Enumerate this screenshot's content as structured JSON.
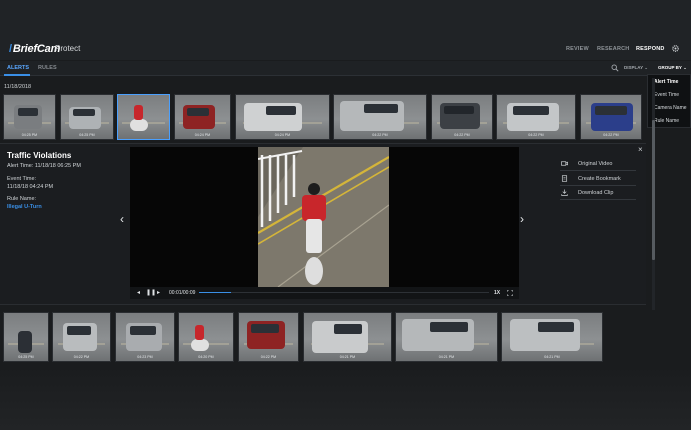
{
  "header": {
    "logo_brand": "BriefCam",
    "logo_product": "Protect",
    "nav": [
      {
        "label": "REVIEW",
        "active": false
      },
      {
        "label": "RESEARCH",
        "active": false
      },
      {
        "label": "RESPOND",
        "active": true
      }
    ],
    "settings_icon": "gear-icon"
  },
  "tabs": [
    {
      "label": "ALERTS",
      "active": true
    },
    {
      "label": "RULES",
      "active": false
    }
  ],
  "toolbar": {
    "search_icon": "search-icon",
    "display_label": "DISPLAY",
    "group_by_label": "GROUP BY",
    "group_by_menu": [
      "Alert Time",
      "Event Time",
      "Camera Name",
      "Rule Name"
    ]
  },
  "date_group": "11/18/2018",
  "top_thumbnails": [
    {
      "time": "04:25 PM",
      "subject": "gray car"
    },
    {
      "time": "04:25 PM",
      "subject": "silver car"
    },
    {
      "time": "",
      "subject": "red scooter rider",
      "selected": true
    },
    {
      "time": "04:24 PM",
      "subject": "red car"
    },
    {
      "time": "04:24 PM",
      "subject": "white van"
    },
    {
      "time": "04:22 PM",
      "subject": "silver van"
    },
    {
      "time": "04:22 PM",
      "subject": "dark car"
    },
    {
      "time": "04:22 PM",
      "subject": "silver car"
    },
    {
      "time": "04:22 PM",
      "subject": "blue car"
    }
  ],
  "detail": {
    "title": "Traffic Violations",
    "alert_time_label": "Alert Time:",
    "alert_time_value": "11/18/18 06:25 PM",
    "event_time_label": "Event Time:",
    "event_time_value": "11/18/18 04:24 PM",
    "rule_name_label": "Rule Name:",
    "rule_name_value": "Illegal U-Turn",
    "actions": [
      {
        "label": "Original Video",
        "icon": "video-camera-icon"
      },
      {
        "label": "Create Bookmark",
        "icon": "bookmark-icon"
      },
      {
        "label": "Download Clip",
        "icon": "download-icon"
      }
    ],
    "close_icon": "close-icon",
    "prev_icon": "chevron-left-icon",
    "next_icon": "chevron-right-icon"
  },
  "player": {
    "timecode": "00:01/00:09",
    "progress_fraction": 0.11,
    "speed": "1X",
    "prev_frame_icon": "step-back-icon",
    "pause_icon": "pause-icon",
    "next_frame_icon": "step-forward-icon",
    "expand_icon": "expand-icon"
  },
  "bottom_thumbnails": [
    {
      "time": "04:25 PM",
      "subject": "motorcyclist"
    },
    {
      "time": "04:22 PM",
      "subject": "silver car"
    },
    {
      "time": "04:23 PM",
      "subject": "silver car"
    },
    {
      "time": "04:20 PM",
      "subject": "scooter rider"
    },
    {
      "time": "04:22 PM",
      "subject": "red car"
    },
    {
      "time": "04:21 PM",
      "subject": "silver van"
    },
    {
      "time": "04:21 PM",
      "subject": "silver van"
    },
    {
      "time": "04:21 PM",
      "subject": "silver van"
    }
  ],
  "colors": {
    "accent": "#3a8fe6",
    "background": "#1a1c1e",
    "header": "#202326"
  }
}
